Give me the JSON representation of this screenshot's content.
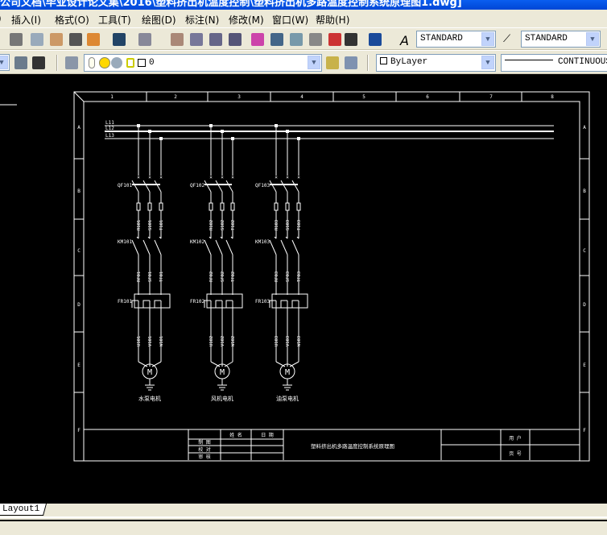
{
  "window": {
    "title": "公司文档\\毕业设计论文集\\2016\\塑料挤出机温度控制\\塑料挤出机多路温度控制系统原理图1.dwg]"
  },
  "menu": [
    "插入(I)",
    "格式(O)",
    "工具(T)",
    "绘图(D)",
    "标注(N)",
    "修改(M)",
    "窗口(W)",
    "帮助(H)"
  ],
  "toolbar": {
    "text_style": "STANDARD",
    "dim_style": "STANDARD",
    "layer": "0",
    "color": "ByLayer",
    "linetype": "CONTINUOUS",
    "icons": [
      "cut-icon",
      "copy-icon",
      "paste-icon",
      "match-properties-icon",
      "block-editor-icon",
      "undo-icon",
      "redo-icon",
      "pan-icon",
      "zoom-realtime-icon",
      "zoom-window-icon",
      "zoom-previous-icon",
      "properties-icon",
      "design-center-icon",
      "tool-palettes-icon",
      "sheet-set-icon",
      "markup-icon",
      "calculator-icon",
      "help-icon"
    ]
  },
  "drawing": {
    "columns": [
      "1",
      "2",
      "3",
      "4",
      "5",
      "6",
      "7",
      "8"
    ],
    "rows": [
      "A",
      "B",
      "C",
      "D",
      "E",
      "F"
    ],
    "buses": [
      "L11",
      "L12",
      "L13"
    ],
    "groups": [
      {
        "breaker": "QF101",
        "contactor": "KM101",
        "relay": "FR101",
        "wires_top": [
          "R101",
          "S101",
          "T101"
        ],
        "wires_mid": [
          "RF01",
          "SF01",
          "TF01"
        ],
        "wires_bot": [
          "U101",
          "V101",
          "W101"
        ],
        "motor": "M",
        "name": "水泵电机"
      },
      {
        "breaker": "QF102",
        "contactor": "KM102",
        "relay": "FR102",
        "wires_top": [
          "R102",
          "S102",
          "T102"
        ],
        "wires_mid": [
          "RF02",
          "SF02",
          "TF02"
        ],
        "wires_bot": [
          "U102",
          "V102",
          "W102"
        ],
        "motor": "M",
        "name": "风机电机"
      },
      {
        "breaker": "QF103",
        "contactor": "KM103",
        "relay": "FR103",
        "wires_top": [
          "R103",
          "S103",
          "T103"
        ],
        "wires_mid": [
          "RF03",
          "SF03",
          "TF03"
        ],
        "wires_bot": [
          "U103",
          "V103",
          "W103"
        ],
        "motor": "M",
        "name": "油泵电机"
      }
    ],
    "title_block": {
      "name": "姓 名",
      "date": "日 期",
      "drawn": "制 图",
      "checked": "校 对",
      "approved": "审 核",
      "title": "塑料挤出机多路温度控制系统原理图",
      "user": "用 户",
      "page": "页 号"
    }
  },
  "layout_tab": "Layout1"
}
